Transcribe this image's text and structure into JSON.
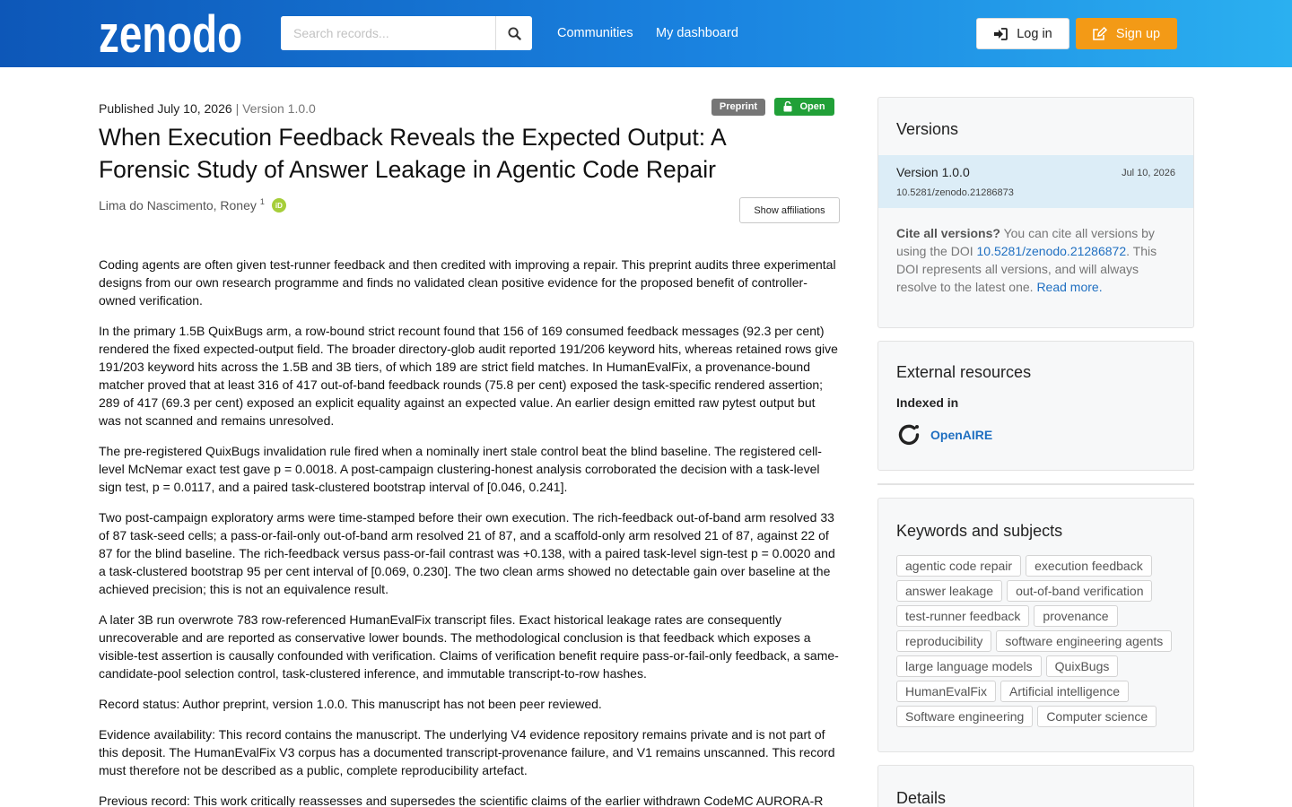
{
  "header": {
    "logo_text": "zenodo",
    "search_placeholder": "Search records...",
    "nav": [
      "Communities",
      "My dashboard"
    ],
    "login_label": "Log in",
    "signup_label": "Sign up"
  },
  "record": {
    "published": "Published July 10, 2026",
    "separator": "|",
    "version": "Version 1.0.0",
    "badge_type": "Preprint",
    "badge_access": "Open",
    "title": "When Execution Feedback Reveals the Expected Output: A Forensic Study of Answer Leakage in Agentic Code Repair",
    "creator_name": "Lima do Nascimento, Roney",
    "creator_affiliation_marker": "1",
    "orcid_label": "iD",
    "show_affiliations_label": "Show affiliations",
    "abstract": [
      "Coding agents are often given test-runner feedback and then credited with improving a repair. This preprint audits three experimental designs from our own research programme and finds no validated clean positive evidence for the proposed benefit of controller-owned verification.",
      "In the primary 1.5B QuixBugs arm, a row-bound strict recount found that 156 of 169 consumed feedback messages (92.3 per cent) rendered the fixed expected-output field. The broader directory-glob audit reported 191/206 keyword hits, whereas retained rows give 191/203 keyword hits across the 1.5B and 3B tiers, of which 189 are strict field matches. In HumanEvalFix, a provenance-bound matcher proved that at least 316 of 417 out-of-band feedback rounds (75.8 per cent) exposed the task-specific rendered assertion; 289 of 417 (69.3 per cent) exposed an explicit equality against an expected value. An earlier design emitted raw pytest output but was not scanned and remains unresolved.",
      "The pre-registered QuixBugs invalidation rule fired when a nominally inert stale control beat the blind baseline. The registered cell-level McNemar exact test gave p = 0.0018. A post-campaign clustering-honest analysis corroborated the decision with a task-level sign test, p = 0.0117, and a paired task-clustered bootstrap interval of [0.046, 0.241].",
      "Two post-campaign exploratory arms were time-stamped before their own execution. The rich-feedback out-of-band arm resolved 33 of 87 task-seed cells; a pass-or-fail-only out-of-band arm resolved 21 of 87, and a scaffold-only arm resolved 21 of 87, against 22 of 87 for the blind baseline. The rich-feedback versus pass-or-fail contrast was +0.138, with a paired task-level sign-test p = 0.0020 and a task-clustered bootstrap 95 per cent interval of [0.069, 0.230]. The two clean arms showed no detectable gain over baseline at the achieved precision; this is not an equivalence result.",
      "A later 3B run overwrote 783 row-referenced HumanEvalFix transcript files. Exact historical leakage rates are consequently unrecoverable and are reported as conservative lower bounds. The methodological conclusion is that feedback which exposes a visible-test assertion is causally confounded with verification. Claims of verification benefit require pass-or-fail-only feedback, a same-candidate-pool selection control, task-clustered inference, and immutable transcript-to-row hashes.",
      "Record status: Author preprint, version 1.0.0. This manuscript has not been peer reviewed.",
      "Evidence availability: This record contains the manuscript. The underlying V4 evidence repository remains private and is not part of this deposit. The HumanEvalFix V3 corpus has a documented transcript-provenance failure, and V1 remains unscanned. This record must therefore not be described as a public, complete reproducibility artefact.",
      "Previous record: This work critically reassesses and supersedes the scientific claims of the earlier withdrawn CodeMC AURORA-R"
    ]
  },
  "sidebar": {
    "versions": {
      "title": "Versions",
      "item_name": "Version 1.0.0",
      "item_date": "Jul 10, 2026",
      "item_doi": "10.5281/zenodo.21286873",
      "cite_bold": "Cite all versions?",
      "cite_text_1": " You can cite all versions by using the DOI ",
      "cite_doi": "10.5281/zenodo.21286872",
      "cite_text_2": ". This DOI represents all versions, and will always resolve to the latest one. ",
      "read_more": "Read more."
    },
    "external": {
      "title": "External resources",
      "indexed_label": "Indexed in",
      "openaire": "OpenAIRE"
    },
    "keywords": {
      "title": "Keywords and subjects",
      "items": [
        "agentic code repair",
        "execution feedback",
        "answer leakage",
        "out-of-band verification",
        "test-runner feedback",
        "provenance",
        "reproducibility",
        "software engineering agents",
        "large language models",
        "QuixBugs",
        "HumanEvalFix",
        "Artificial intelligence",
        "Software engineering",
        "Computer science"
      ]
    },
    "details": {
      "title": "Details"
    }
  },
  "colors": {
    "header_start": "#0d57b8",
    "header_end": "#2bb0f0",
    "signup": "#f39a16",
    "open_badge": "#21a038",
    "link": "#1f6fc1"
  }
}
